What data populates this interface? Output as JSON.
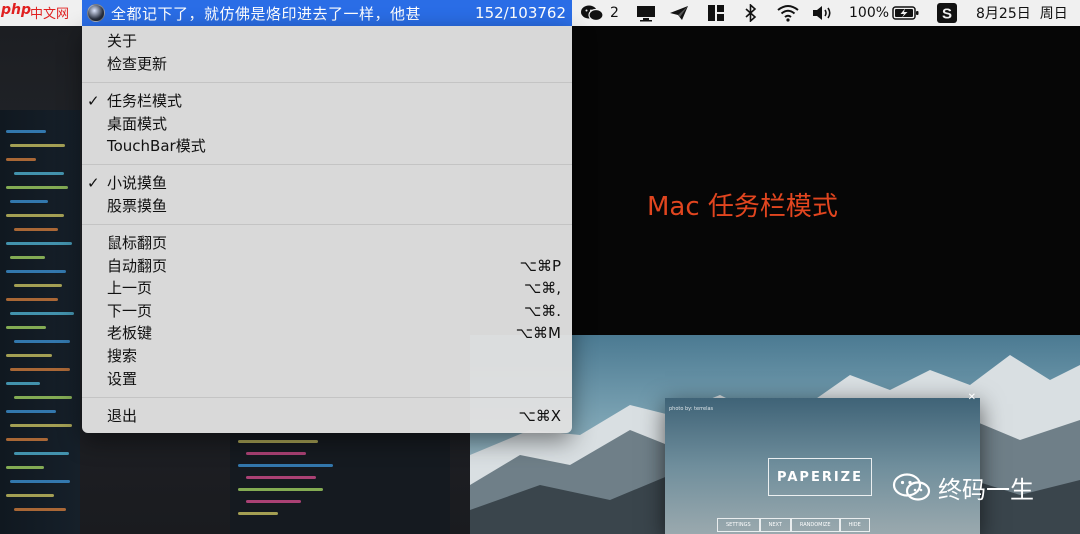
{
  "menubar": {
    "site_logo_php": "php",
    "site_logo_text": "中文网",
    "novel_line": "全都记下了，就仿佛是烙印进去了一样，他甚",
    "progress": "152/103762",
    "wechat_count": "2",
    "battery": "100%",
    "date": "8月25日",
    "weekday": "周日"
  },
  "menu": {
    "about": "关于",
    "check_update": "检查更新",
    "mode_taskbar": "任务栏模式",
    "mode_desktop": "桌面模式",
    "mode_touchbar": "TouchBar模式",
    "read_novel": "小说摸鱼",
    "read_stock": "股票摸鱼",
    "mouse_flip": "鼠标翻页",
    "auto_flip": "自动翻页",
    "auto_flip_sc": "⌥⌘P",
    "prev_page": "上一页",
    "prev_page_sc": "⌥⌘,",
    "next_page": "下一页",
    "next_page_sc": "⌥⌘.",
    "boss_key": "老板键",
    "boss_key_sc": "⌥⌘M",
    "search": "搜索",
    "settings": "设置",
    "quit": "退出",
    "quit_sc": "⌥⌘X",
    "check_mark": "✓"
  },
  "annotation": "Mac 任务栏模式",
  "wechat_mark": "终码一生",
  "paperize": {
    "photo_by": "photo by: terrelas",
    "logo": "PAPERIZE",
    "btn_settings": "SETTINGS",
    "btn_next": "NEXT",
    "btn_randomize": "RANDOMIZE",
    "btn_hide": "HIDE"
  },
  "colors": {
    "highlight": "#2a6de6",
    "annotation": "#e1451f",
    "menu_bg": "#e1e1e1"
  }
}
